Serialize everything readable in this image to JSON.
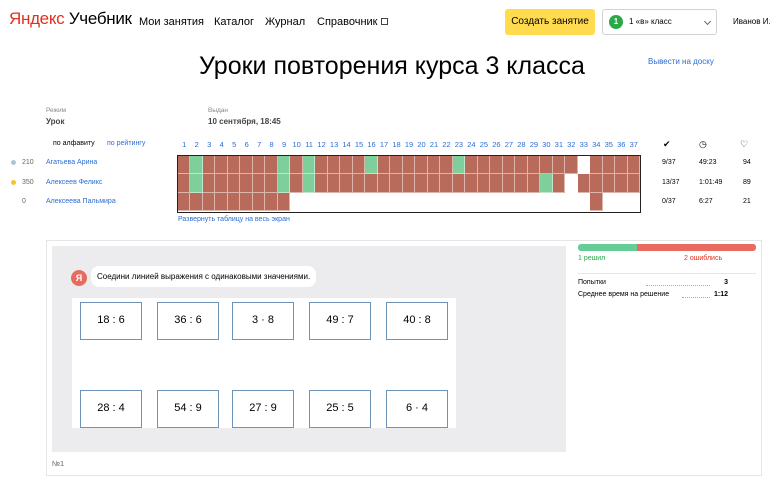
{
  "header": {
    "logo_yandex": "Яндекс",
    "logo_product": "Учебник",
    "nav": [
      "Мои занятия",
      "Каталог",
      "Журнал",
      "Справочник"
    ],
    "create_button": "Создать занятие",
    "class_number": "1",
    "class_label": "1 «в» класс",
    "user": "Иванов И."
  },
  "page": {
    "title": "Уроки повторения курса 3 класса",
    "board_link": "Вывести на доску"
  },
  "meta": {
    "mode_label": "Режим",
    "mode_value": "Урок",
    "issued_label": "Выдан",
    "issued_value": "10 сентября, 18:45"
  },
  "table": {
    "sort_alpha": "по алфавиту",
    "sort_rating": "по рейтингу",
    "columns": [
      "1",
      "2",
      "3",
      "4",
      "5",
      "6",
      "7",
      "8",
      "9",
      "10",
      "11",
      "12",
      "13",
      "14",
      "15",
      "16",
      "17",
      "18",
      "19",
      "20",
      "21",
      "22",
      "23",
      "24",
      "25",
      "26",
      "27",
      "28",
      "29",
      "30",
      "31",
      "32",
      "33",
      "34",
      "35",
      "36",
      "37"
    ],
    "stat_icons": [
      "check-icon",
      "timer-icon",
      "heart-icon"
    ],
    "students": [
      {
        "rating": "210",
        "dot": "#a8c6d8",
        "name": "Агатьева Арина",
        "solved": "9/37",
        "time": "49:23",
        "score": "94"
      },
      {
        "rating": "350",
        "dot": "#f2c531",
        "name": "Алексеев Феликс",
        "solved": "13/37",
        "time": "1:01:49",
        "score": "89"
      },
      {
        "rating": "0",
        "dot": "",
        "name": "Алексеева Пальмира",
        "solved": "0/37",
        "time": "6:27",
        "score": "21"
      }
    ],
    "grid_rows": [
      "wswwwwwwswswwwwswwwwwwswwwwwwwwwpwwww",
      "wswwwwwwswswwwwwwwwwwwwwwwwwwswpwwwwww",
      "wwwwwwwwppppppppppppppppppppppppwpppp"
    ],
    "expand_link": "Развернуть таблицу на весь экран"
  },
  "task": {
    "avatar_letter": "Я",
    "instruction": "Соедини линией выражения с одинаковыми значениями.",
    "top_expressions": [
      "18 : 6",
      "36 : 6",
      "3 · 8",
      "49 : 7",
      "40 : 8"
    ],
    "bottom_expressions": [
      "28 : 4",
      "54 : 9",
      "27 : 9",
      "25 : 5",
      "6 · 4"
    ],
    "number": "№1"
  },
  "results": {
    "solved_label": "1 решил",
    "error_label": "2 ошиблись",
    "solved_fraction": 0.333,
    "colors": {
      "solved": "#66cc98",
      "error": "#e96a5e"
    },
    "attempts_label": "Попытки",
    "attempts_value": "3",
    "avg_time_label": "Среднее время на решение",
    "avg_time_value": "1:12"
  }
}
